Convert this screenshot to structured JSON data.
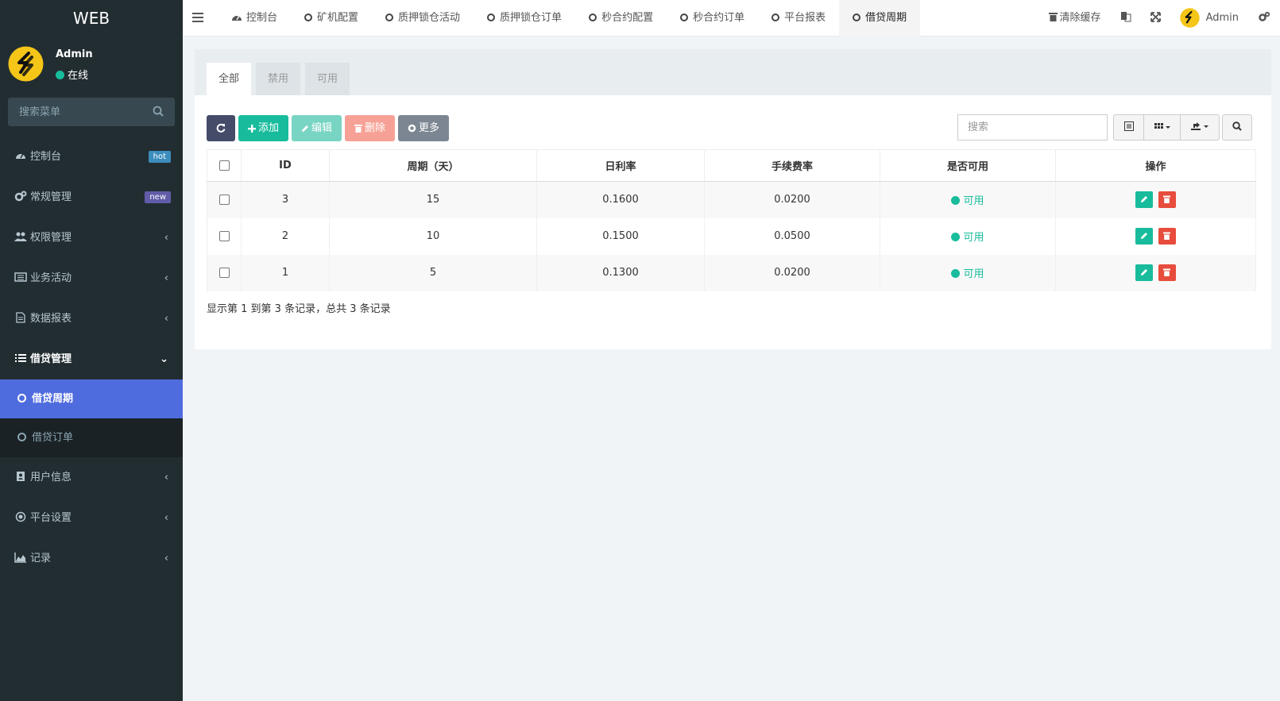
{
  "app": {
    "logo_text": "WEB"
  },
  "user": {
    "name": "Admin",
    "status": "在线"
  },
  "sidebar": {
    "search_placeholder": "搜索菜单",
    "items": [
      {
        "label": "控制台",
        "icon": "dashboard-icon",
        "badge": "hot",
        "badge_color": "#3c8dbc"
      },
      {
        "label": "常规管理",
        "icon": "cogs-icon",
        "badge": "new",
        "badge_color": "#605ca8"
      },
      {
        "label": "权限管理",
        "icon": "users-icon"
      },
      {
        "label": "业务活动",
        "icon": "list-alt-icon"
      },
      {
        "label": "数据报表",
        "icon": "file-icon"
      },
      {
        "label": "借贷管理",
        "icon": "list-icon"
      },
      {
        "label": "用户信息",
        "icon": "address-book-icon"
      },
      {
        "label": "平台设置",
        "icon": "dot-circle-icon"
      },
      {
        "label": "记录",
        "icon": "area-chart-icon"
      }
    ],
    "submenu": [
      {
        "label": "借贷周期",
        "active": true
      },
      {
        "label": "借贷订单",
        "active": false
      }
    ]
  },
  "topbar": {
    "tabs": [
      {
        "label": "控制台",
        "icon": "dashboard-icon"
      },
      {
        "label": "矿机配置"
      },
      {
        "label": "质押锁仓活动"
      },
      {
        "label": "质押锁仓订单"
      },
      {
        "label": "秒合约配置"
      },
      {
        "label": "秒合约订单"
      },
      {
        "label": "平台报表"
      },
      {
        "label": "借贷周期",
        "active": true
      }
    ],
    "clear_cache": "清除缓存",
    "user_name": "Admin"
  },
  "panel": {
    "filter_tabs": [
      "全部",
      "禁用",
      "可用"
    ],
    "toolbar": {
      "add": "添加",
      "edit": "编辑",
      "delete": "删除",
      "more": "更多"
    },
    "search_placeholder": "搜索",
    "columns": [
      "ID",
      "周期（天）",
      "日利率",
      "手续费率",
      "是否可用",
      "操作"
    ],
    "rows": [
      {
        "id": "3",
        "period": "15",
        "daily_rate": "0.1600",
        "fee_rate": "0.0200",
        "status": "可用"
      },
      {
        "id": "2",
        "period": "10",
        "daily_rate": "0.1500",
        "fee_rate": "0.0500",
        "status": "可用"
      },
      {
        "id": "1",
        "period": "5",
        "daily_rate": "0.1300",
        "fee_rate": "0.0200",
        "status": "可用"
      }
    ],
    "summary": "显示第 1 到第 3 条记录，总共 3 条记录"
  },
  "colors": {
    "primary": "#18bc9c",
    "sidebar_bg": "#222d32",
    "active_sub": "#4f6cde",
    "danger": "#e74c3c"
  }
}
